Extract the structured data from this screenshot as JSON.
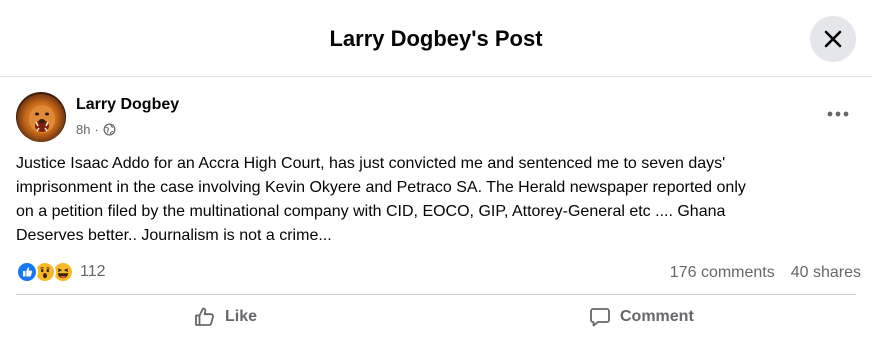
{
  "header": {
    "title": "Larry Dogbey's Post",
    "close_icon": "close-icon"
  },
  "post": {
    "author": "Larry Dogbey",
    "time": "8h",
    "privacy_icon": "globe-icon",
    "more_icon": "more-horizontal-icon",
    "text_lines": [
      "Justice Isaac Addo for an Accra High Court, has just convicted me and sentenced me to seven days'",
      "imprisonment in the case involving Kevin Okyere and Petraco SA. The Herald newspaper reported only",
      "on a petition filed by the multinational company with CID, EOCO, GIP, Attorey-General etc .... Ghana",
      "Deserves better.. Journalism is not a crime..."
    ]
  },
  "reactions": {
    "types": [
      "like",
      "wow",
      "haha"
    ],
    "count": "112"
  },
  "stats": {
    "comments": "176 comments",
    "shares": "40 shares"
  },
  "actions": {
    "like_label": "Like",
    "comment_label": "Comment"
  },
  "colors": {
    "like_blue": "#1877f2",
    "emoji_yellow": "#f7b928",
    "secondary_text": "#65676b"
  }
}
